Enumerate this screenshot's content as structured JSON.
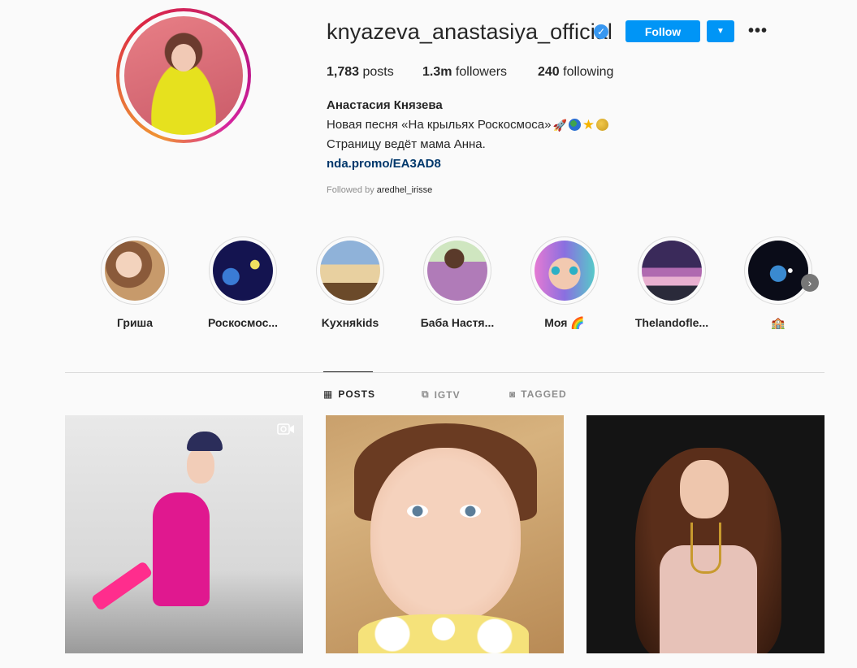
{
  "profile": {
    "username": "knyazeva_anastasiya_official",
    "verified": true,
    "follow_label": "Follow",
    "stats": {
      "posts_count": "1,783",
      "posts_label": "posts",
      "followers_count": "1.3m",
      "followers_label": "followers",
      "following_count": "240",
      "following_label": "following"
    },
    "full_name": "Анастасия Князева",
    "bio_line1": "Новая песня «На крыльях Роскосмоса»",
    "bio_line2": "Страницу ведёт мама Анна.",
    "link": "nda.promo/EA3AD8",
    "followed_by_label": "Followed by",
    "followed_by_user": "aredhel_irisse"
  },
  "highlights": [
    {
      "label": "Гриша",
      "color": "#c79a6b"
    },
    {
      "label": "Роскосмос...",
      "color": "#1a1a5e"
    },
    {
      "label": "Kухняkids",
      "color": "#6f8fb4"
    },
    {
      "label": "Баба Настя...",
      "color": "#b07bb8"
    },
    {
      "label": "Моя 🌈",
      "color": "#d59bd8"
    },
    {
      "label": "Thelandofle...",
      "color": "#5a4a7a"
    },
    {
      "label": "🏫",
      "color": "#0d1020"
    }
  ],
  "tabs": [
    {
      "label": "POSTS",
      "active": true
    },
    {
      "label": "IGTV",
      "active": false
    },
    {
      "label": "TAGGED",
      "active": false
    }
  ],
  "colors": {
    "accent": "#0095f6",
    "link": "#00376b",
    "muted": "#8e8e8e",
    "border": "#dbdbdb"
  }
}
